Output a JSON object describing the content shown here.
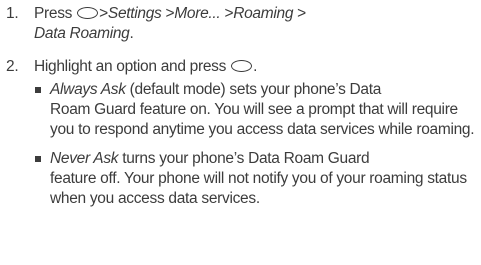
{
  "step1": {
    "number": "1.",
    "press": "Press",
    "path": [
      {
        "sep": ">",
        "label": "Settings"
      },
      {
        "sep": ">",
        "label": "More..."
      },
      {
        "sep": ">",
        "label": "Roaming"
      },
      {
        "sep": ">",
        "label": ""
      }
    ],
    "last_label": "Data Roaming",
    "end": "."
  },
  "step2": {
    "number": "2.",
    "text": "Highlight an option and press",
    "end": "."
  },
  "options": [
    {
      "name": "Always Ask",
      "desc_line1": " (default mode) sets your phone’s Data",
      "desc_rest": "Roam Guard feature on. You will see a prompt that will require you to respond anytime you access data services while roaming."
    },
    {
      "name": "Never Ask",
      "desc_line1": " turns your phone’s Data Roam Guard",
      "desc_rest": "feature off. Your phone will not notify you of your roaming status when you access data services."
    }
  ]
}
